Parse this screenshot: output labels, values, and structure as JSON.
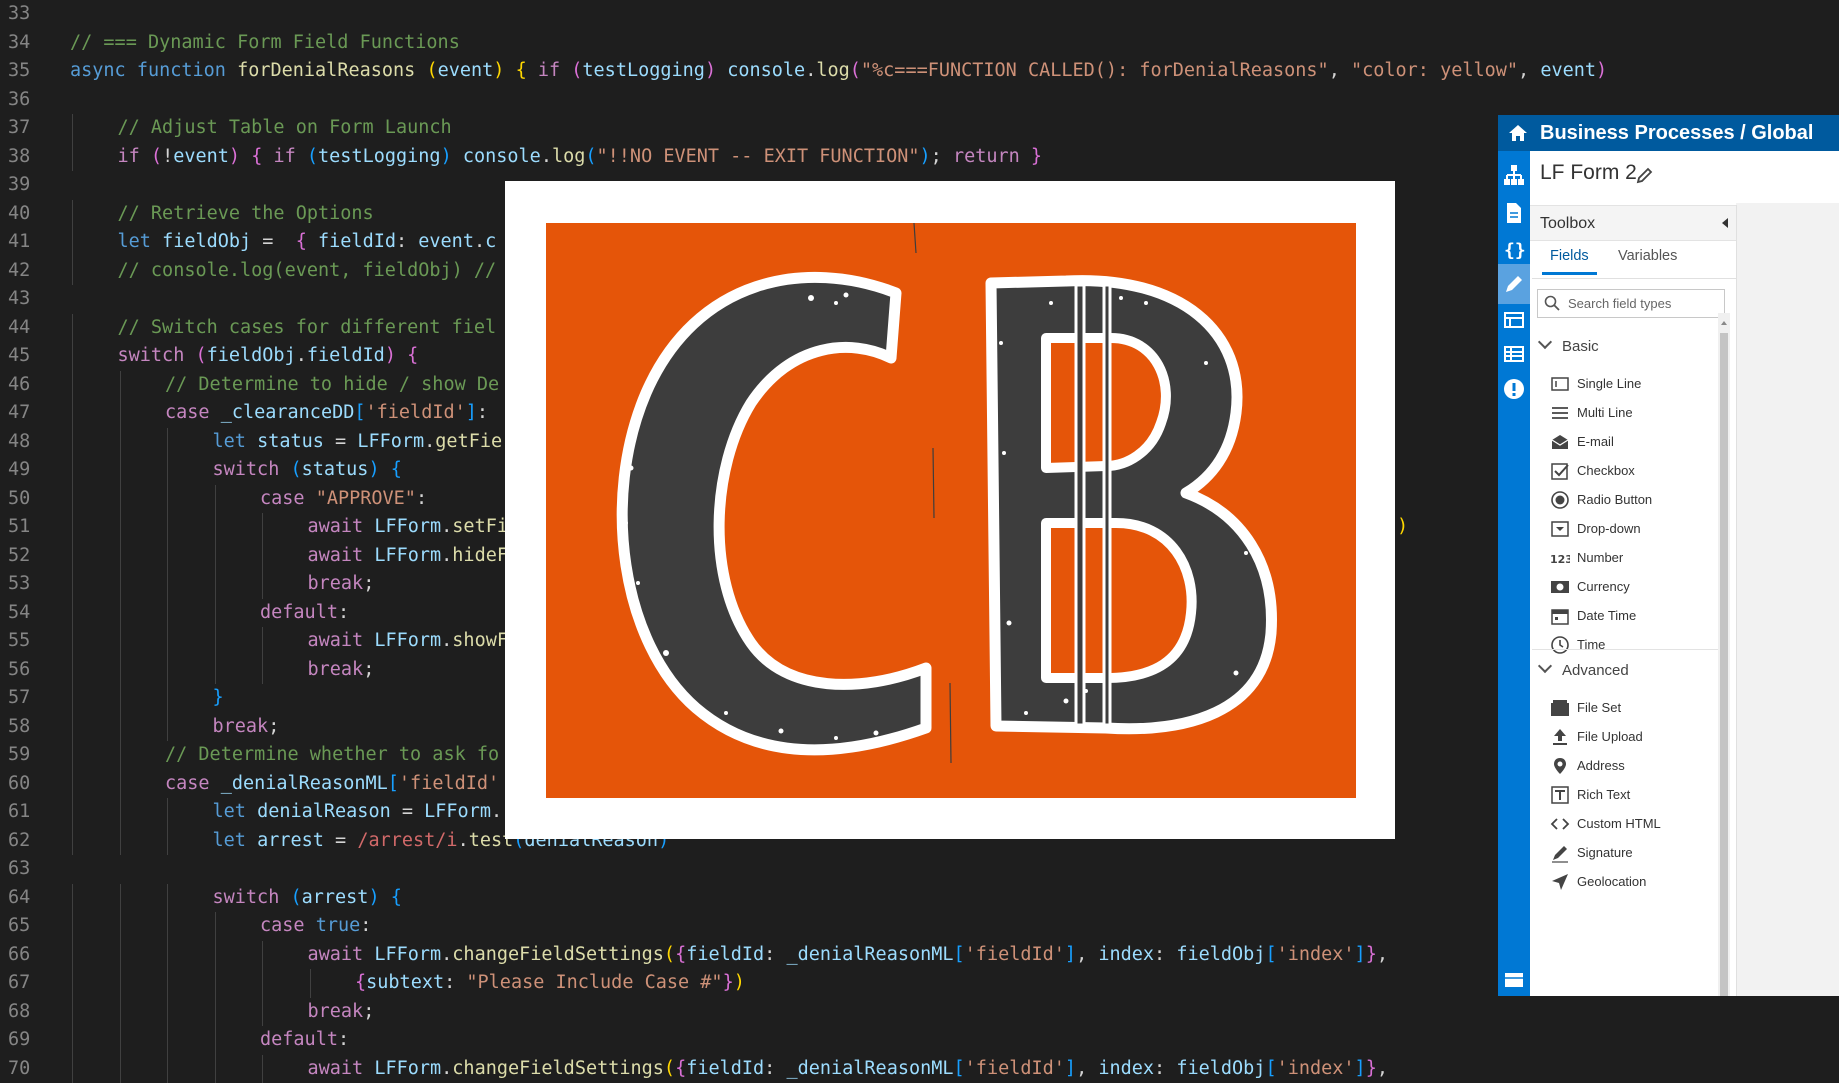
{
  "editor": {
    "lines": [
      {
        "n": "33",
        "indent": 0,
        "tokens": []
      },
      {
        "n": "34",
        "indent": 0,
        "tokens": [
          [
            "cm",
            "// === Dynamic Form Field Functions"
          ]
        ]
      },
      {
        "n": "35",
        "indent": 0,
        "tokens": [
          [
            "kw",
            "async "
          ],
          [
            "kw",
            "function "
          ],
          [
            "fn",
            "forDenialReasons "
          ],
          [
            "p1",
            "("
          ],
          [
            "var",
            "event"
          ],
          [
            "p1",
            ")"
          ],
          [
            "txt",
            " "
          ],
          [
            "p1",
            "{"
          ],
          [
            "txt",
            " "
          ],
          [
            "ctl",
            "if "
          ],
          [
            "p2",
            "("
          ],
          [
            "var",
            "testLogging"
          ],
          [
            "p2",
            ")"
          ],
          [
            "txt",
            " "
          ],
          [
            "var",
            "console"
          ],
          [
            "txt",
            "."
          ],
          [
            "fn",
            "log"
          ],
          [
            "p2",
            "("
          ],
          [
            "str",
            "\"%c===FUNCTION CALLED(): forDenialReasons\""
          ],
          [
            "txt",
            ", "
          ],
          [
            "str",
            "\"color: yellow\""
          ],
          [
            "txt",
            ", "
          ],
          [
            "var",
            "event"
          ],
          [
            "p2",
            ")"
          ]
        ]
      },
      {
        "n": "36",
        "indent": 0,
        "tokens": []
      },
      {
        "n": "37",
        "indent": 1,
        "tokens": [
          [
            "cm",
            "// Adjust Table on Form Launch"
          ]
        ]
      },
      {
        "n": "38",
        "indent": 1,
        "tokens": [
          [
            "ctl",
            "if "
          ],
          [
            "p2",
            "("
          ],
          [
            "txt",
            "!"
          ],
          [
            "var",
            "event"
          ],
          [
            "p2",
            ")"
          ],
          [
            "txt",
            " "
          ],
          [
            "p2",
            "{"
          ],
          [
            "txt",
            " "
          ],
          [
            "ctl",
            "if "
          ],
          [
            "p3",
            "("
          ],
          [
            "var",
            "testLogging"
          ],
          [
            "p3",
            ")"
          ],
          [
            "txt",
            " "
          ],
          [
            "var",
            "console"
          ],
          [
            "txt",
            "."
          ],
          [
            "fn",
            "log"
          ],
          [
            "p3",
            "("
          ],
          [
            "str",
            "\"!!NO EVENT -- EXIT FUNCTION\""
          ],
          [
            "p3",
            ")"
          ],
          [
            "txt",
            "; "
          ],
          [
            "ctl",
            "return "
          ],
          [
            "p2",
            "}"
          ]
        ]
      },
      {
        "n": "39",
        "indent": 1,
        "tokens": []
      },
      {
        "n": "40",
        "indent": 1,
        "tokens": [
          [
            "cm",
            "// Retrieve the Options"
          ]
        ]
      },
      {
        "n": "41",
        "indent": 1,
        "tokens": [
          [
            "kw",
            "let "
          ],
          [
            "var",
            "fieldObj"
          ],
          [
            "txt",
            " =  "
          ],
          [
            "p2",
            "{"
          ],
          [
            "txt",
            " "
          ],
          [
            "var",
            "fieldId"
          ],
          [
            "txt",
            ": "
          ],
          [
            "var",
            "event"
          ],
          [
            "txt",
            "."
          ],
          [
            "var",
            "c"
          ]
        ]
      },
      {
        "n": "42",
        "indent": 1,
        "tokens": [
          [
            "cm",
            "// console.log(event, fieldObj) //"
          ]
        ]
      },
      {
        "n": "43",
        "indent": 1,
        "tokens": []
      },
      {
        "n": "44",
        "indent": 1,
        "tokens": [
          [
            "cm",
            "// Switch cases for different fiel"
          ]
        ]
      },
      {
        "n": "45",
        "indent": 1,
        "tokens": [
          [
            "ctl",
            "switch "
          ],
          [
            "p2",
            "("
          ],
          [
            "var",
            "fieldObj"
          ],
          [
            "txt",
            "."
          ],
          [
            "var",
            "fieldId"
          ],
          [
            "p2",
            ")"
          ],
          [
            "txt",
            " "
          ],
          [
            "p2",
            "{"
          ]
        ]
      },
      {
        "n": "46",
        "indent": 2,
        "tokens": [
          [
            "cm",
            "// Determine to hide / show De"
          ]
        ]
      },
      {
        "n": "47",
        "indent": 2,
        "tokens": [
          [
            "ctl",
            "case "
          ],
          [
            "var",
            "_clearanceDD"
          ],
          [
            "p3",
            "["
          ],
          [
            "str",
            "'fieldId'"
          ],
          [
            "p3",
            "]"
          ],
          [
            "txt",
            ":"
          ]
        ]
      },
      {
        "n": "48",
        "indent": 3,
        "tokens": [
          [
            "kw",
            "let "
          ],
          [
            "var",
            "status"
          ],
          [
            "txt",
            " = "
          ],
          [
            "var",
            "LFForm"
          ],
          [
            "txt",
            "."
          ],
          [
            "fn",
            "getFie"
          ]
        ]
      },
      {
        "n": "49",
        "indent": 3,
        "tokens": [
          [
            "ctl",
            "switch "
          ],
          [
            "p3",
            "("
          ],
          [
            "var",
            "status"
          ],
          [
            "p3",
            ")"
          ],
          [
            "txt",
            " "
          ],
          [
            "p3",
            "{"
          ]
        ]
      },
      {
        "n": "50",
        "indent": 4,
        "tokens": [
          [
            "ctl",
            "case "
          ],
          [
            "str",
            "\"APPROVE\""
          ],
          [
            "txt",
            ":"
          ]
        ]
      },
      {
        "n": "51",
        "indent": 5,
        "tokens": [
          [
            "ctl",
            "await "
          ],
          [
            "var",
            "LFForm"
          ],
          [
            "txt",
            "."
          ],
          [
            "fn",
            "setFi"
          ]
        ],
        "tail": [
          [
            "p1",
            ")"
          ]
        ]
      },
      {
        "n": "52",
        "indent": 5,
        "tokens": [
          [
            "ctl",
            "await "
          ],
          [
            "var",
            "LFForm"
          ],
          [
            "txt",
            "."
          ],
          [
            "fn",
            "hideF"
          ]
        ]
      },
      {
        "n": "53",
        "indent": 5,
        "tokens": [
          [
            "ctl",
            "break"
          ],
          [
            "txt",
            ";"
          ]
        ]
      },
      {
        "n": "54",
        "indent": 4,
        "tokens": [
          [
            "ctl",
            "default"
          ],
          [
            "txt",
            ":"
          ]
        ]
      },
      {
        "n": "55",
        "indent": 5,
        "tokens": [
          [
            "ctl",
            "await "
          ],
          [
            "var",
            "LFForm"
          ],
          [
            "txt",
            "."
          ],
          [
            "fn",
            "showF"
          ]
        ]
      },
      {
        "n": "56",
        "indent": 5,
        "tokens": [
          [
            "ctl",
            "break"
          ],
          [
            "txt",
            ";"
          ]
        ]
      },
      {
        "n": "57",
        "indent": 3,
        "tokens": [
          [
            "p3",
            "}"
          ]
        ]
      },
      {
        "n": "58",
        "indent": 3,
        "tokens": [
          [
            "ctl",
            "break"
          ],
          [
            "txt",
            ";"
          ]
        ]
      },
      {
        "n": "59",
        "indent": 2,
        "tokens": [
          [
            "cm",
            "// Determine whether to ask fo"
          ]
        ]
      },
      {
        "n": "60",
        "indent": 2,
        "tokens": [
          [
            "ctl",
            "case "
          ],
          [
            "var",
            "_denialReasonML"
          ],
          [
            "p3",
            "["
          ],
          [
            "str",
            "'fieldId'"
          ]
        ]
      },
      {
        "n": "61",
        "indent": 3,
        "tokens": [
          [
            "kw",
            "let "
          ],
          [
            "var",
            "denialReason"
          ],
          [
            "txt",
            " = "
          ],
          [
            "var",
            "LFForm"
          ],
          [
            "txt",
            "."
          ]
        ],
        "tail": [
          [
            "p3",
            "}"
          ],
          [
            "p1",
            ")"
          ]
        ]
      },
      {
        "n": "62",
        "indent": 3,
        "tokens": [
          [
            "kw",
            "let "
          ],
          [
            "var",
            "arrest"
          ],
          [
            "txt",
            " = "
          ],
          [
            "re",
            "/arrest/i"
          ],
          [
            "txt",
            "."
          ],
          [
            "fn",
            "test"
          ],
          [
            "p3",
            "("
          ],
          [
            "var",
            "denialReason"
          ],
          [
            "p3",
            ")"
          ]
        ]
      },
      {
        "n": "63",
        "indent": 3,
        "tokens": []
      },
      {
        "n": "64",
        "indent": 3,
        "tokens": [
          [
            "ctl",
            "switch "
          ],
          [
            "p3",
            "("
          ],
          [
            "var",
            "arrest"
          ],
          [
            "p3",
            ")"
          ],
          [
            "txt",
            " "
          ],
          [
            "p3",
            "{"
          ]
        ]
      },
      {
        "n": "65",
        "indent": 4,
        "tokens": [
          [
            "ctl",
            "case "
          ],
          [
            "kw",
            "true"
          ],
          [
            "txt",
            ":"
          ]
        ]
      },
      {
        "n": "66",
        "indent": 5,
        "tokens": [
          [
            "ctl",
            "await "
          ],
          [
            "var",
            "LFForm"
          ],
          [
            "txt",
            "."
          ],
          [
            "fn",
            "changeFieldSettings"
          ],
          [
            "p1",
            "("
          ],
          [
            "p2",
            "{"
          ],
          [
            "var",
            "fieldId"
          ],
          [
            "txt",
            ": "
          ],
          [
            "var",
            "_denialReasonML"
          ],
          [
            "p3",
            "["
          ],
          [
            "str",
            "'fieldId'"
          ],
          [
            "p3",
            "]"
          ],
          [
            "txt",
            ", "
          ],
          [
            "var",
            "index"
          ],
          [
            "txt",
            ": "
          ],
          [
            "var",
            "fieldObj"
          ],
          [
            "p3",
            "["
          ],
          [
            "str",
            "'index'"
          ],
          [
            "p3",
            "]"
          ],
          [
            "p2",
            "}"
          ],
          [
            "txt",
            ","
          ]
        ]
      },
      {
        "n": "67",
        "indent": 6,
        "tokens": [
          [
            "p2",
            "{"
          ],
          [
            "var",
            "subtext"
          ],
          [
            "txt",
            ": "
          ],
          [
            "str",
            "\"Please Include Case #\""
          ],
          [
            "p2",
            "}"
          ],
          [
            "p1",
            ")"
          ]
        ]
      },
      {
        "n": "68",
        "indent": 5,
        "tokens": [
          [
            "ctl",
            "break"
          ],
          [
            "txt",
            ";"
          ]
        ]
      },
      {
        "n": "69",
        "indent": 4,
        "tokens": [
          [
            "ctl",
            "default"
          ],
          [
            "txt",
            ":"
          ]
        ]
      },
      {
        "n": "70",
        "indent": 5,
        "tokens": [
          [
            "ctl",
            "await "
          ],
          [
            "var",
            "LFForm"
          ],
          [
            "txt",
            "."
          ],
          [
            "fn",
            "changeFieldSettings"
          ],
          [
            "p1",
            "("
          ],
          [
            "p2",
            "{"
          ],
          [
            "var",
            "fieldId"
          ],
          [
            "txt",
            ": "
          ],
          [
            "var",
            "_denialReasonML"
          ],
          [
            "p3",
            "["
          ],
          [
            "str",
            "'fieldId'"
          ],
          [
            "p3",
            "]"
          ],
          [
            "txt",
            ", "
          ],
          [
            "var",
            "index"
          ],
          [
            "txt",
            ": "
          ],
          [
            "var",
            "fieldObj"
          ],
          [
            "p3",
            "["
          ],
          [
            "str",
            "'index'"
          ],
          [
            "p3",
            "]"
          ],
          [
            "p2",
            "}"
          ],
          [
            "txt",
            ","
          ]
        ]
      }
    ]
  },
  "logo": {
    "text": "CB",
    "frame_color": "#ffffff",
    "background_color": "#e55509",
    "letter_color": "#3d3d3d",
    "outline_color": "#ffffff"
  },
  "lf_panel": {
    "breadcrumb": "Business Processes / Global",
    "form_title": "LF Form 2",
    "toolbox_title": "Toolbox",
    "tabs": [
      "Fields",
      "Variables"
    ],
    "search_placeholder": "Search field types",
    "sections": [
      {
        "label": "Basic",
        "items": [
          {
            "label": "Single Line",
            "icon": "single-line-icon"
          },
          {
            "label": "Multi Line",
            "icon": "multi-line-icon"
          },
          {
            "label": "E-mail",
            "icon": "email-icon"
          },
          {
            "label": "Checkbox",
            "icon": "checkbox-icon"
          },
          {
            "label": "Radio Button",
            "icon": "radio-button-icon"
          },
          {
            "label": "Drop-down",
            "icon": "dropdown-icon"
          },
          {
            "label": "Number",
            "icon": "number-icon"
          },
          {
            "label": "Currency",
            "icon": "currency-icon"
          },
          {
            "label": "Date Time",
            "icon": "date-time-icon"
          },
          {
            "label": "Time",
            "icon": "time-icon"
          }
        ]
      },
      {
        "label": "Advanced",
        "items": [
          {
            "label": "File Set",
            "icon": "file-set-icon"
          },
          {
            "label": "File Upload",
            "icon": "file-upload-icon"
          },
          {
            "label": "Address",
            "icon": "address-icon"
          },
          {
            "label": "Rich Text",
            "icon": "rich-text-icon"
          },
          {
            "label": "Custom HTML",
            "icon": "custom-html-icon"
          },
          {
            "label": "Signature",
            "icon": "signature-icon"
          },
          {
            "label": "Geolocation",
            "icon": "geolocation-icon"
          }
        ]
      }
    ],
    "rail_icons": [
      "process-diagram-icon",
      "document-icon",
      "variables-icon",
      "edit-form-icon",
      "form-table-icon",
      "form-grid-icon",
      "alert-icon",
      "inbox-icon"
    ],
    "colors": {
      "header": "#005a9e",
      "rail": "#0078d4",
      "accent": "#0078d4"
    }
  }
}
